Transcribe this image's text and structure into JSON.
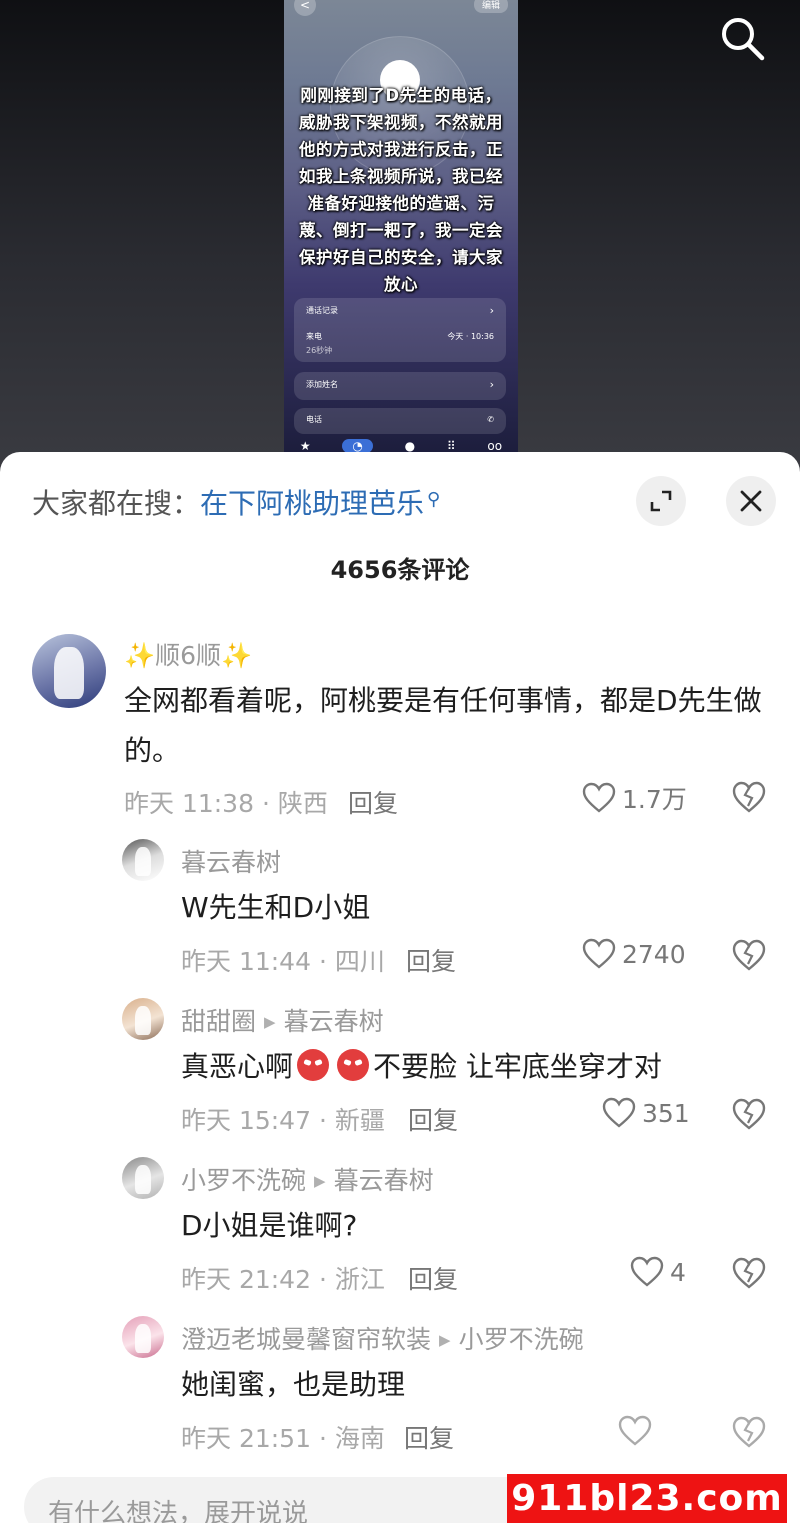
{
  "video": {
    "phone_back": "<",
    "phone_edit": "编辑",
    "overlay_text": "刚刚接到了D先生的电话，威胁我下架视频，不然就用他的方式对我进行反击，正如我上条视频所说，我已经准备好迎接他的造谣、污蔑、倒打一耙了，我一定会保护好自己的安全，请大家放心",
    "call_record_label": "通话记录",
    "incoming_label": "来电",
    "incoming_time": "今天 · 10:36",
    "incoming_duration": "26秒钟",
    "add_name_label": "添加姓名",
    "phone_label": "电话"
  },
  "sheet": {
    "search_prefix": "大家都在搜：",
    "search_query": "在下阿桃助理芭乐",
    "comment_count": "4656条评论"
  },
  "comments": [
    {
      "username": "✨顺6顺✨",
      "text": "全网都看着呢，阿桃要是有任何事情，都是D先生做的。",
      "meta": "昨天 11:38 · 陕西",
      "reply_label": "回复",
      "likes": "1.7万"
    },
    {
      "username": "暮云春树",
      "text": "W先生和D小姐",
      "meta": "昨天 11:44 · 四川",
      "reply_label": "回复",
      "likes": "2740"
    },
    {
      "username": "甜甜圈",
      "reply_to": "暮云春树",
      "text_before": "真恶心啊",
      "text_after": "不要脸 让牢底坐穿才对",
      "meta": "昨天 15:47 · 新疆",
      "reply_label": "回复",
      "likes": "351"
    },
    {
      "username": "小罗不洗碗",
      "reply_to": "暮云春树",
      "text": "D小姐是谁啊?",
      "meta": "昨天 21:42 · 浙江",
      "reply_label": "回复",
      "likes": "4"
    },
    {
      "username": "澄迈老城曼馨窗帘软装",
      "reply_to": "小罗不洗碗",
      "text": "她闺蜜，也是助理",
      "meta": "昨天 21:51 · 海南",
      "reply_label": "回复",
      "likes": ""
    }
  ],
  "input": {
    "placeholder": "有什么想法，展开说说"
  },
  "watermark": "911bl23.com",
  "colors": {
    "link": "#2d6cb4",
    "watermark_bg": "#ee1313",
    "meta_text": "#a8a8a8"
  }
}
